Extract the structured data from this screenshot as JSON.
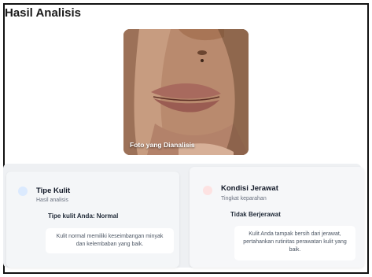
{
  "header": {
    "title": "Hasil Analisis"
  },
  "photo": {
    "caption": "Foto yang Dianalisis"
  },
  "skin_type": {
    "title": "Tipe Kulit",
    "subtitle": "Hasil analisis",
    "result": "Tipe kulit Anda: Normal",
    "description": "Kulit normal memiliki keseimbangan minyak dan kelembaban yang baik.",
    "dot_color": "#dbeafe"
  },
  "acne": {
    "title": "Kondisi Jerawat",
    "subtitle": "Tingkat keparahan",
    "result": "Tidak Berjerawat",
    "description": "Kulit Anda tampak bersih dari jerawat, pertahankan rutinitas perawatan kulit yang baik.",
    "dot_color": "#fde2e2"
  }
}
